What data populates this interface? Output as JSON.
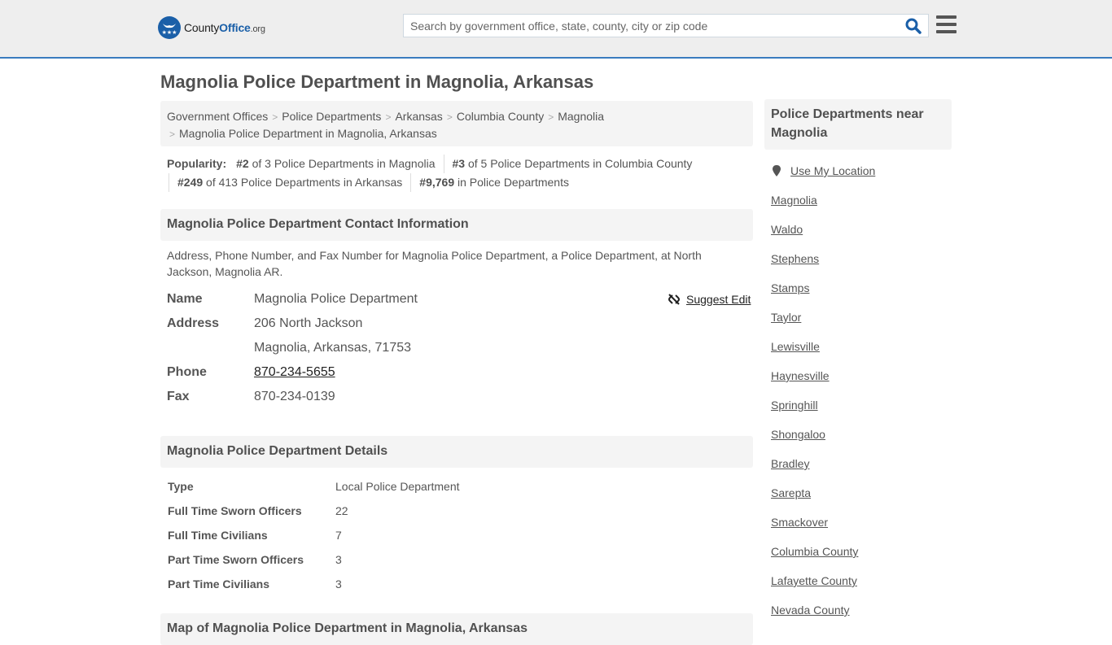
{
  "header": {
    "logo": {
      "brand_a": "County",
      "brand_b": "Office",
      "brand_c": ".org"
    },
    "search_placeholder": "Search by government office, state, county, city or zip code",
    "search_value": ""
  },
  "page_title": "Magnolia Police Department in Magnolia, Arkansas",
  "breadcrumb": [
    "Government Offices",
    "Police Departments",
    "Arkansas",
    "Columbia County",
    "Magnolia",
    "Magnolia Police Department in Magnolia, Arkansas"
  ],
  "popularity": {
    "label": "Popularity:",
    "items": [
      {
        "rank": "#2",
        "text": " of 3 Police Departments in Magnolia"
      },
      {
        "rank": "#3",
        "text": " of 5 Police Departments in Columbia County"
      },
      {
        "rank": "#249",
        "text": " of 413 Police Departments in Arkansas"
      },
      {
        "rank": "#9,769",
        "text": " in Police Departments"
      }
    ]
  },
  "contact": {
    "heading": "Magnolia Police Department Contact Information",
    "description": "Address, Phone Number, and Fax Number for Magnolia Police Department, a Police Department, at North Jackson, Magnolia AR.",
    "suggest_edit": "Suggest Edit",
    "name_label": "Name",
    "name": "Magnolia Police Department",
    "address_label": "Address",
    "address_line1": "206 North Jackson",
    "address_line2": "Magnolia, Arkansas, 71753",
    "phone_label": "Phone",
    "phone": "870-234-5655",
    "fax_label": "Fax",
    "fax": "870-234-0139"
  },
  "details": {
    "heading": "Magnolia Police Department Details",
    "rows": [
      {
        "label": "Type",
        "value": "Local Police Department"
      },
      {
        "label": "Full Time Sworn Officers",
        "value": "22"
      },
      {
        "label": "Full Time Civilians",
        "value": "7"
      },
      {
        "label": "Part Time Sworn Officers",
        "value": "3"
      },
      {
        "label": "Part Time Civilians",
        "value": "3"
      }
    ]
  },
  "map_heading": "Map of Magnolia Police Department in Magnolia, Arkansas",
  "sidebar": {
    "heading": "Police Departments near Magnolia",
    "use_location": "Use My Location",
    "items": [
      "Magnolia",
      "Waldo",
      "Stephens",
      "Stamps",
      "Taylor",
      "Lewisville",
      "Haynesville",
      "Springhill",
      "Shongaloo",
      "Bradley",
      "Sarepta",
      "Smackover",
      "Columbia County",
      "Lafayette County",
      "Nevada County"
    ]
  },
  "colors": {
    "brand_blue": "#1a5fa8",
    "header_bg": "#eeeeee",
    "header_border": "#3a7bbf",
    "panel_bg": "#f4f4f4"
  }
}
